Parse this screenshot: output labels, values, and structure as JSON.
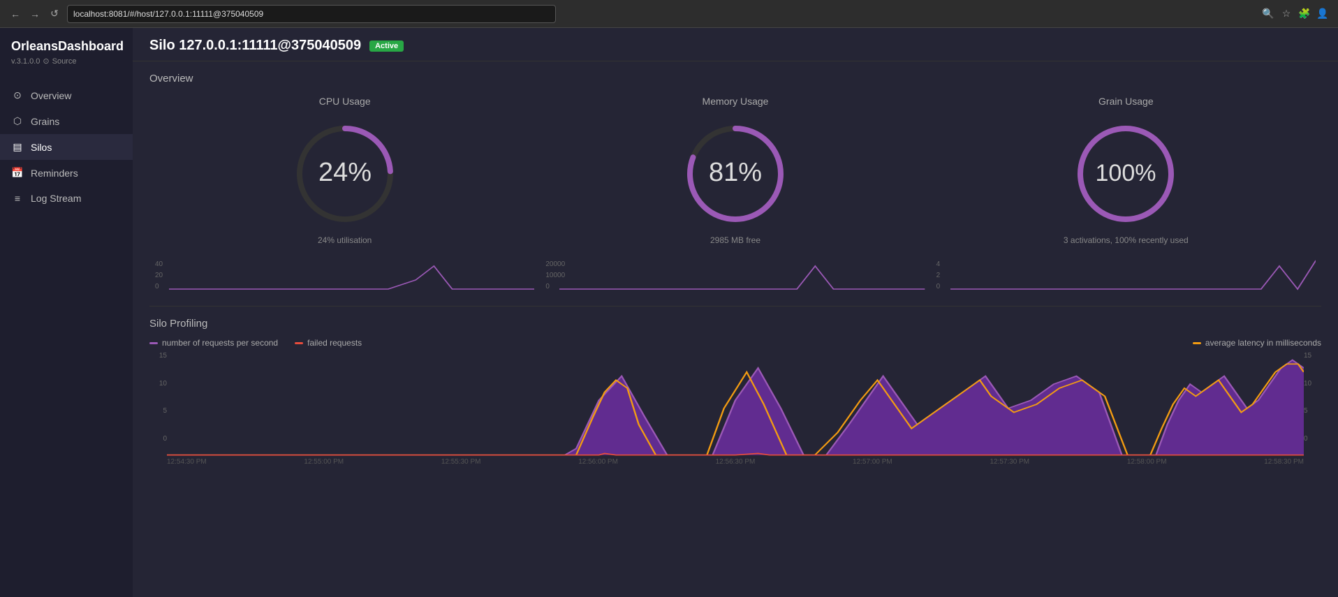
{
  "browser": {
    "url": "localhost:8081/#/host/127.0.0.1:11111@375040509",
    "back_btn": "←",
    "forward_btn": "→",
    "reload_btn": "↺"
  },
  "sidebar": {
    "brand": "OrleansDashboard",
    "version": "v.3.1.0.0",
    "source_label": "Source",
    "nav_items": [
      {
        "id": "overview",
        "label": "Overview",
        "icon": "⊙",
        "active": false
      },
      {
        "id": "grains",
        "label": "Grains",
        "icon": "⬡",
        "active": false
      },
      {
        "id": "silos",
        "label": "Silos",
        "icon": "▤",
        "active": true
      },
      {
        "id": "reminders",
        "label": "Reminders",
        "icon": "📅",
        "active": false
      },
      {
        "id": "logstream",
        "label": "Log Stream",
        "icon": "≡",
        "active": false
      }
    ]
  },
  "page": {
    "title": "Silo 127.0.0.1:11111@375040509",
    "status": "Active",
    "overview_label": "Overview",
    "profiling_label": "Silo Profiling"
  },
  "gauges": {
    "cpu": {
      "label": "CPU Usage",
      "value": "24%",
      "sub": "24% utilisation",
      "percent": 24,
      "color": "#9b59b6"
    },
    "memory": {
      "label": "Memory Usage",
      "value": "81%",
      "sub": "2985 MB free",
      "percent": 81,
      "color": "#9b59b6"
    },
    "grain": {
      "label": "Grain Usage",
      "value": "100%",
      "sub": "3 activations, 100% recently used",
      "percent": 100,
      "color": "#9b59b6"
    }
  },
  "mini_charts": {
    "cpu": {
      "max": "40",
      "mid": "20",
      "min": "0"
    },
    "memory": {
      "max": "20000",
      "mid": "10000",
      "min": "0"
    },
    "grain": {
      "max": "4",
      "mid": "2",
      "min": "0"
    }
  },
  "profiling": {
    "legend": [
      {
        "label": "number of requests per second",
        "color": "#9b59b6"
      },
      {
        "label": "failed requests",
        "color": "#e74c3c"
      },
      {
        "label": "average latency in milliseconds",
        "color": "#f39c12"
      }
    ],
    "y_left": [
      "15",
      "10",
      "5",
      "0"
    ],
    "y_right": [
      "15",
      "10",
      "5",
      "0"
    ],
    "x_labels": [
      "12:54:30 PM",
      "12:55:00 PM",
      "12:55:30 PM",
      "12:56:00 PM",
      "12:56:30 PM",
      "12:57:00 PM",
      "12:57:30 PM",
      "12:58:00 PM",
      "12:58:30 PM"
    ]
  }
}
